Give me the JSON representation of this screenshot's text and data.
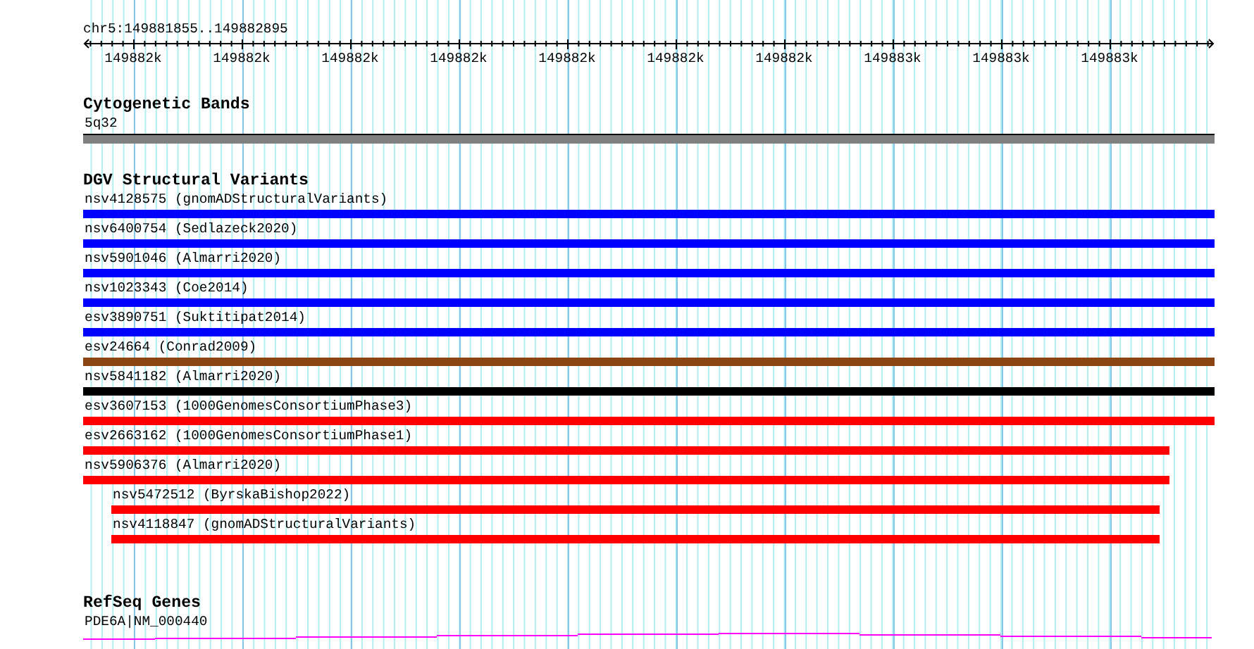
{
  "location": "chr5:149881855..149882895",
  "ruler": {
    "tick_labels": [
      "149882k",
      "149882k",
      "149882k",
      "149882k",
      "149882k",
      "149882k",
      "149882k",
      "149883k",
      "149883k",
      "149883k"
    ]
  },
  "tracks": [
    {
      "kind": "cytoband",
      "title": "Cytogenetic Bands",
      "features": [
        {
          "label": "5q32"
        }
      ]
    },
    {
      "kind": "variants",
      "title": "DGV Structural Variants",
      "features": [
        {
          "label": "nsv4128575 (gnomADStructuralVariants)",
          "color": "#0000ff",
          "kind": "full"
        },
        {
          "label": "nsv6400754 (Sedlazeck2020)",
          "color": "#0000ff",
          "kind": "full"
        },
        {
          "label": "nsv5901046 (Almarri2020)",
          "color": "#0000ff",
          "kind": "full"
        },
        {
          "label": "nsv1023343 (Coe2014)",
          "color": "#0000ff",
          "kind": "full"
        },
        {
          "label": "esv3890751 (Suktitipat2014)",
          "color": "#0000ff",
          "kind": "full"
        },
        {
          "label": "esv24664 (Conrad2009)",
          "color": "#8b4513",
          "kind": "full"
        },
        {
          "label": "nsv5841182 (Almarri2020)",
          "color": "#000000",
          "kind": "full"
        },
        {
          "label": "esv3607153 (1000GenomesConsortiumPhase3)",
          "color": "#ff0000",
          "kind": "full"
        },
        {
          "label": "esv2663162 (1000GenomesConsortiumPhase1)",
          "color": "#ff0000",
          "kind": "short"
        },
        {
          "label": "nsv5906376 (Almarri2020)",
          "color": "#ff0000",
          "kind": "short"
        },
        {
          "label": "nsv5472512 (ByrskaBishop2022)",
          "color": "#ff0000",
          "kind": "inset"
        },
        {
          "label": "nsv4118847 (gnomADStructuralVariants)",
          "color": "#ff0000",
          "kind": "inset"
        }
      ]
    },
    {
      "kind": "gene",
      "title": "RefSeq Genes",
      "features": [
        {
          "label": "PDE6A|NM_000440"
        }
      ]
    }
  ]
}
